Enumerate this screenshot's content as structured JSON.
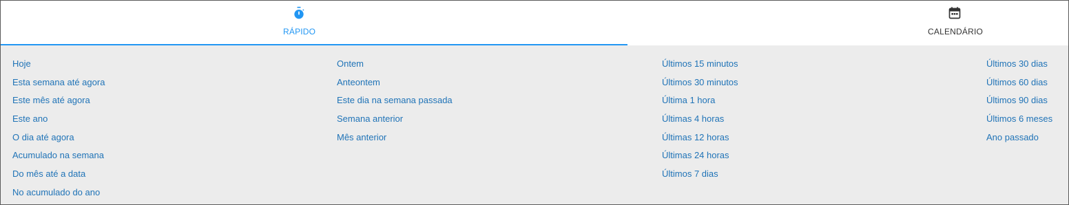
{
  "tabs": {
    "quick": {
      "label": "RÁPIDO",
      "icon": "stopwatch-icon",
      "active": true
    },
    "calendar": {
      "label": "CALENDÁRIO",
      "icon": "calendar-icon",
      "active": false
    }
  },
  "colors": {
    "accent": "#2196f3",
    "link": "#1f73b7",
    "panel_bg": "#ececec",
    "tab_text": "#333333"
  },
  "quick_ranges": {
    "col1": [
      "Hoje",
      "Esta semana até agora",
      "Este mês até agora",
      "Este ano",
      "O dia até agora",
      "Acumulado na semana",
      "Do mês até a data",
      "No acumulado do ano"
    ],
    "col2": [
      "Ontem",
      "Anteontem",
      "Este dia na semana passada",
      "Semana anterior",
      "Mês anterior"
    ],
    "col3": [
      "Últimos 15 minutos",
      "Últimos 30 minutos",
      "Última 1 hora",
      "Últimas 4 horas",
      "Últimas 12 horas",
      "Últimas 24 horas",
      "Últimos 7 dias"
    ],
    "col4": [
      "Últimos 30 dias",
      "Últimos 60 dias",
      "Últimos 90 dias",
      "Últimos 6 meses",
      "Ano passado"
    ]
  }
}
